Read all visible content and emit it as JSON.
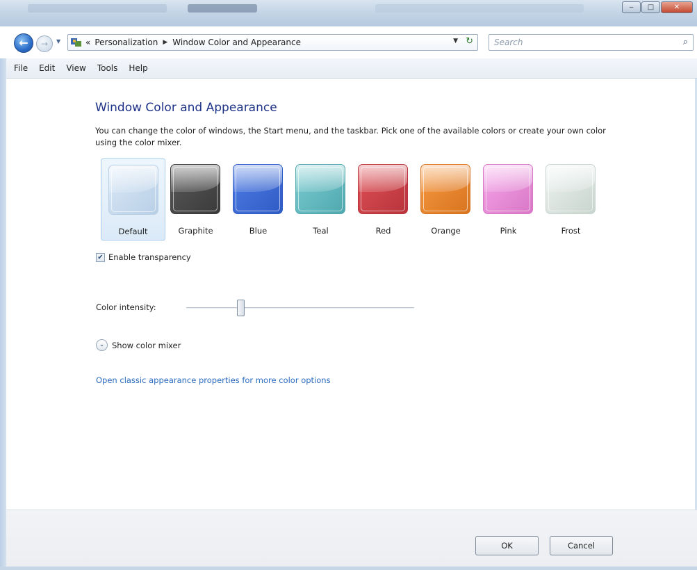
{
  "window": {
    "minimize_icon": "minimize-icon",
    "maximize_icon": "maximize-icon",
    "close_icon": "close-icon"
  },
  "nav": {
    "back_icon": "back-arrow-icon",
    "forward_icon": "forward-arrow-icon",
    "breadcrumb_overflow": "«",
    "breadcrumbs": [
      "Personalization",
      "Window Color and Appearance"
    ],
    "search_placeholder": "Search"
  },
  "menu": [
    "File",
    "Edit",
    "View",
    "Tools",
    "Help"
  ],
  "page": {
    "title": "Window Color and Appearance",
    "description": "You can change the color of windows, the Start menu, and the taskbar. Pick one of the available colors or create your own color using the color mixer."
  },
  "swatches": [
    {
      "label": "Default",
      "color": "#dbe9f7",
      "edge": "#b8cfe6",
      "selected": true
    },
    {
      "label": "Graphite",
      "color": "#5a5a5a",
      "edge": "#3a3a3a",
      "selected": false
    },
    {
      "label": "Blue",
      "color": "#4f7ee6",
      "edge": "#2f5bc4",
      "selected": false
    },
    {
      "label": "Teal",
      "color": "#7ccdd2",
      "edge": "#4fa8ae",
      "selected": false
    },
    {
      "label": "Red",
      "color": "#e05258",
      "edge": "#b8333a",
      "selected": false
    },
    {
      "label": "Orange",
      "color": "#f79a42",
      "edge": "#d8741f",
      "selected": false
    },
    {
      "label": "Pink",
      "color": "#f6a6ea",
      "edge": "#d877c6",
      "selected": false
    },
    {
      "label": "Frost",
      "color": "#eef4f1",
      "edge": "#c8d4ce",
      "selected": false
    }
  ],
  "transparency": {
    "label": "Enable transparency",
    "checked": true
  },
  "intensity": {
    "label": "Color intensity:",
    "value_fraction": 0.24
  },
  "mixer": {
    "label": "Show color mixer",
    "icon": "chevron-down-icon"
  },
  "classic_link": "Open classic appearance properties for more color options",
  "footer": {
    "ok": "OK",
    "cancel": "Cancel"
  }
}
